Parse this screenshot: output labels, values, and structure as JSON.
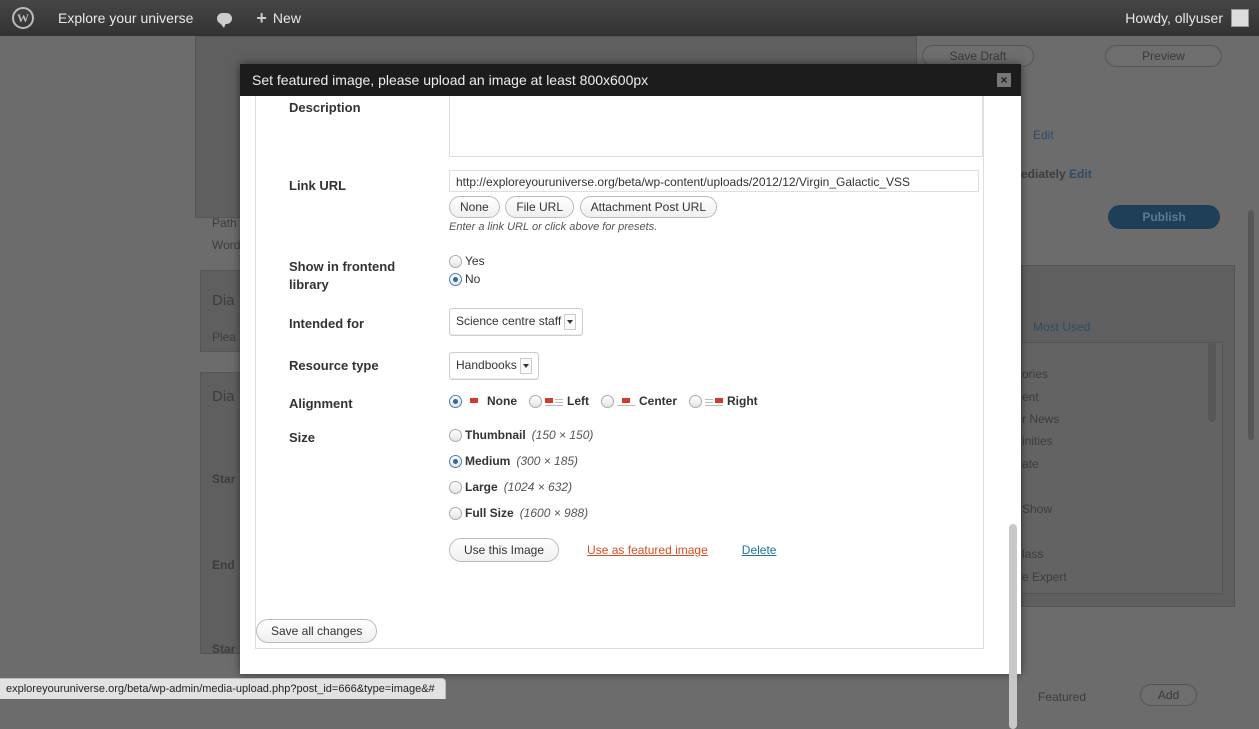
{
  "adminbar": {
    "site_name": "Explore your universe",
    "new_label": "New",
    "howdy": "Howdy, ollyuser"
  },
  "background": {
    "save_draft": "Save Draft",
    "preview": "Preview",
    "edit_link": "Edit",
    "publish_immediately": "ediately",
    "publish": "Publish",
    "most_used": "Most Used",
    "categories": [
      "ories",
      "ent",
      "r News",
      "inities",
      "ate",
      "Show",
      "lass",
      "e Expert"
    ],
    "left_labels": [
      "Path",
      "Word",
      "Dia",
      "Plea",
      "Dia",
      "Star",
      "End",
      "Star"
    ],
    "featured": "Featured",
    "add": "Add"
  },
  "modal": {
    "title": "Set featured image, please upload an image at least 800x600px",
    "close": "×",
    "description_label": "Description",
    "link_url_label": "Link URL",
    "link_url_value": "http://exploreyouruniverse.org/beta/wp-content/uploads/2012/12/Virgin_Galactic_VSS",
    "link_buttons": [
      "None",
      "File URL",
      "Attachment Post URL"
    ],
    "link_hint": "Enter a link URL or click above for presets.",
    "frontend_label": "Show in frontend library",
    "frontend_options": [
      "Yes",
      "No"
    ],
    "frontend_selected": "No",
    "intended_label": "Intended for",
    "intended_value": "Science centre staff",
    "resource_label": "Resource type",
    "resource_value": "Handbooks",
    "alignment_label": "Alignment",
    "alignment_options": [
      "None",
      "Left",
      "Center",
      "Right"
    ],
    "alignment_selected": "None",
    "size_label": "Size",
    "sizes": [
      {
        "name": "Thumbnail",
        "dims": "(150 × 150)"
      },
      {
        "name": "Medium",
        "dims": "(300 × 185)"
      },
      {
        "name": "Large",
        "dims": "(1024 × 632)"
      },
      {
        "name": "Full Size",
        "dims": "(1600 × 988)"
      }
    ],
    "size_selected": "Medium",
    "use_image": "Use this Image",
    "use_featured": "Use as featured image",
    "delete": "Delete",
    "save_all": "Save all changes"
  },
  "status_url": "exploreyouruniverse.org/beta/wp-admin/media-upload.php?post_id=666&type=image&#"
}
